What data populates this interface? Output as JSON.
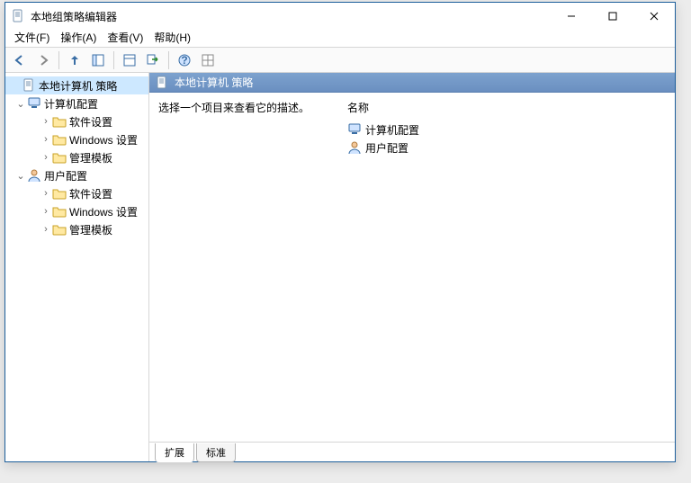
{
  "window": {
    "title": "本地组策略编辑器"
  },
  "menu": {
    "file": "文件(F)",
    "action": "操作(A)",
    "view": "查看(V)",
    "help": "帮助(H)"
  },
  "tree": {
    "root": "本地计算机 策略",
    "computer": "计算机配置",
    "user": "用户配置",
    "soft": "软件设置",
    "windows": "Windows 设置",
    "admin": "管理模板"
  },
  "right": {
    "header": "本地计算机 策略",
    "desc": "选择一个项目来查看它的描述。",
    "col_name": "名称",
    "item_computer": "计算机配置",
    "item_user": "用户配置",
    "tab_ext": "扩展",
    "tab_std": "标准"
  }
}
